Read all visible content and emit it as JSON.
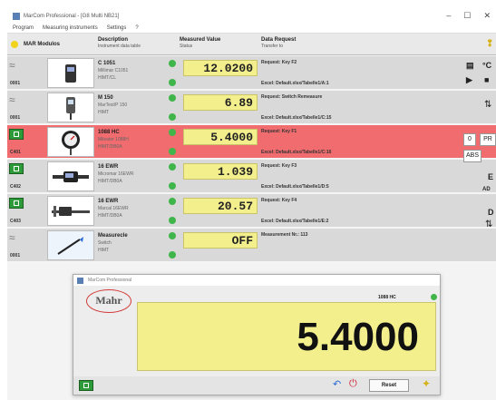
{
  "window": {
    "title": "MarCom Professional - [G8 Multi NB21]",
    "controls": [
      "–",
      "☐",
      "✕"
    ]
  },
  "menu": [
    "Program",
    "Measuring instruments",
    "Settings",
    "?"
  ],
  "header": {
    "mode_label": "MAR Modulos",
    "col_description": "Description",
    "col_description_sub": "Instrument data table",
    "col_value": "Measured Value",
    "col_value_sub": "Status",
    "col_request": "Data Request",
    "col_request_sub": "Transfer to"
  },
  "rows": [
    {
      "code": "0001",
      "desc": "C 1051",
      "desc_sub1": "Millimar C1051",
      "desc_sub2": "HIMT/CL",
      "value": "12.0200",
      "status": "ok",
      "request": "Request: Key F2",
      "transfer": "Excel: Default.xlsx/Tabelle1/A:1"
    },
    {
      "code": "0001",
      "desc": "M 150",
      "desc_sub1": "MarTest/P 150",
      "desc_sub2": "HIMT",
      "value": "6.89",
      "status": "ok",
      "request": "Request: Switch Remeasure",
      "transfer": "Excel: Default.xlsx/Tabelle1/C:15"
    },
    {
      "code": "C401",
      "desc": "1088 HC",
      "desc_sub1": "Mileater 1088H",
      "desc_sub2": "HIMT/DB0A",
      "value": "5.4000",
      "status": "ok",
      "request": "Request: Key F1",
      "transfer": "Excel: Default.xlsx/Tabelle1/C:16"
    },
    {
      "code": "C402",
      "desc": "16 EWR",
      "desc_sub1": "Micromar 16EWR",
      "desc_sub2": "HIMT/DB0A",
      "value": "1.039",
      "status": "ok",
      "request": "Request: Key F3",
      "transfer": "Excel: Default.xlsx/Tabelle1/D:5"
    },
    {
      "code": "C403",
      "desc": "16 EWR",
      "desc_sub1": "Marcal 16EWR",
      "desc_sub2": "HIMT/DB0A",
      "value": "20.57",
      "status": "ok",
      "request": "Request: Key F4",
      "transfer": "Excel: Default.xlsx/Tabelle1/E:2"
    },
    {
      "code": "0001",
      "desc": "Measurecle",
      "desc_sub1": "Switch",
      "desc_sub2": "HIMT",
      "value": "OFF",
      "status": "ok",
      "request": "Measurement Nr.: 113",
      "transfer": ""
    }
  ],
  "right_panel": {
    "unit_mm": "°C",
    "btn_zero": "0",
    "btn_pr": "PR",
    "btn_abs": "ABS",
    "btn_e": "E",
    "btn_ad": "AD",
    "btn_d": "D"
  },
  "dialog": {
    "title": "MarCom Professional",
    "brand": "Mahr",
    "instrument_label": "1088 HC",
    "big_value": "5.4000",
    "reset_label": "Reset"
  },
  "colors": {
    "selected_row": "#f06c6f",
    "value_field": "#f4ef8d",
    "status_ok": "#3fb54a"
  }
}
